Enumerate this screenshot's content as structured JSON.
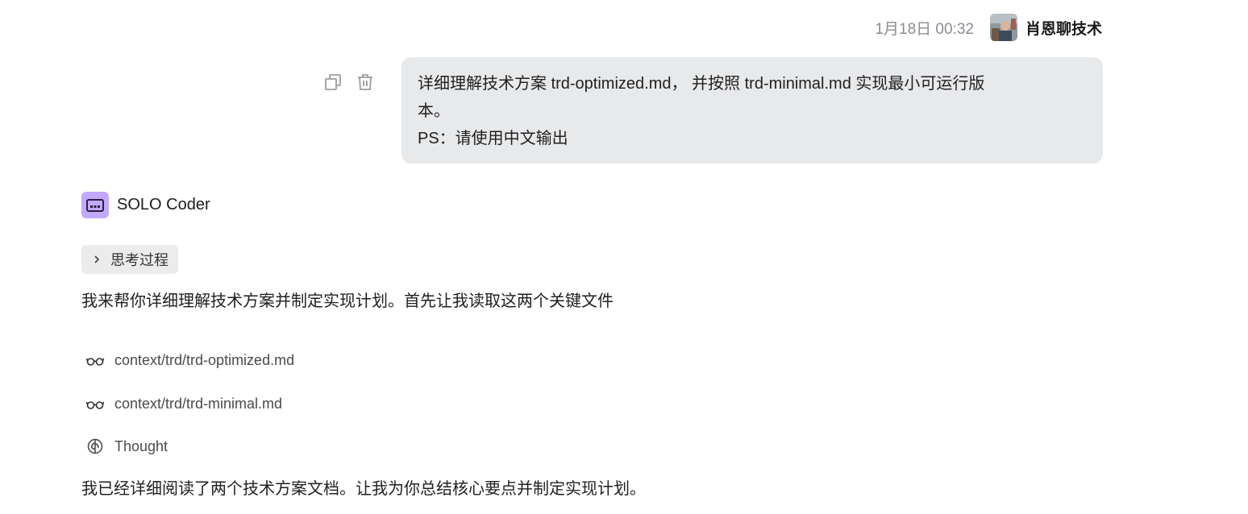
{
  "user_message": {
    "timestamp": "1月18日 00:32",
    "username": "肖恩聊技术",
    "lines": [
      "详细理解技术方案 trd-optimized.md， 并按照 trd-minimal.md 实现最小可运行版",
      "本。",
      "PS：请使用中文输出"
    ],
    "icons": [
      "copy-icon",
      "trash-icon"
    ]
  },
  "assistant": {
    "name": "SOLO Coder",
    "thinking_label": "思考过程",
    "intro": "我来帮你详细理解技术方案并制定实现计划。首先让我读取这两个关键文件",
    "files": [
      "context/trd/trd-optimized.md",
      "context/trd/trd-minimal.md"
    ],
    "thought_label": "Thought",
    "summary": "我已经详细阅读了两个技术方案文档。让我为你总结核心要点并制定实现计划。"
  },
  "colors": {
    "bubble_bg": "#e8e9eb",
    "bot_icon_bg": "#c4a8ff",
    "timestamp": "#8a8d93"
  }
}
